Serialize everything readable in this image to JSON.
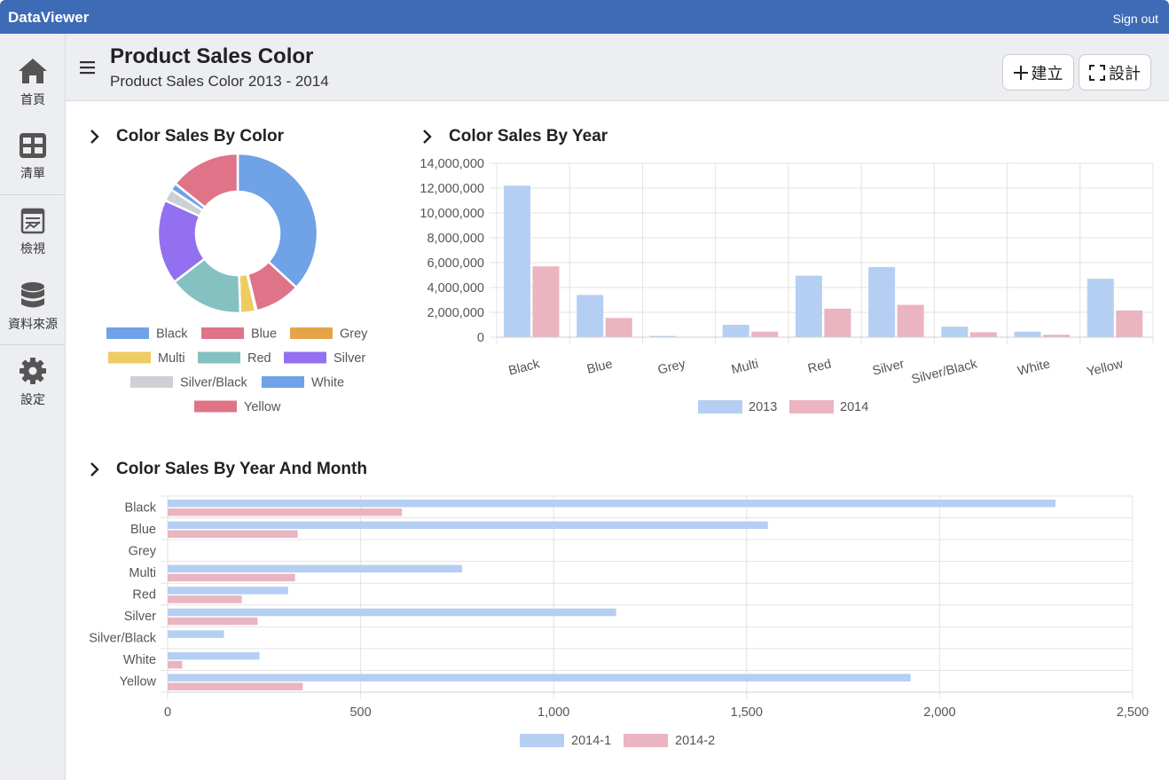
{
  "app": {
    "brand": "DataViewer",
    "signout": "Sign out"
  },
  "sidebar": {
    "items": [
      {
        "label": "首頁",
        "icon": "home-icon"
      },
      {
        "label": "清單",
        "icon": "grid-icon"
      },
      {
        "label": "檢視",
        "icon": "view-icon"
      },
      {
        "label": "資料來源",
        "icon": "database-icon"
      },
      {
        "label": "設定",
        "icon": "gear-icon"
      }
    ]
  },
  "header": {
    "title": "Product Sales Color",
    "subtitle": "Product Sales Color 2013 - 2014",
    "create_label": "建立",
    "design_label": "設計"
  },
  "sections": {
    "by_color": "Color Sales By Color",
    "by_year": "Color Sales By Year",
    "by_month": "Color Sales By Year And Month"
  },
  "colors": {
    "blue": "#6fa2e6",
    "pink": "#df7488",
    "bar_blue": "#b5cff2",
    "bar_pink": "#eab4c0",
    "topbar": "#3d6bb5"
  },
  "chart_data": [
    {
      "type": "pie",
      "title": "Color Sales By Color",
      "labels": [
        "Black",
        "Blue",
        "Grey",
        "Multi",
        "Red",
        "Silver",
        "Silver/Black",
        "White",
        "Yellow"
      ],
      "values": [
        17.8,
        4.5,
        0.1,
        1.5,
        7.3,
        8.3,
        1.2,
        0.7,
        6.9
      ],
      "colors": [
        "#6fa2e6",
        "#df7488",
        "#e6a44a",
        "#efcb63",
        "#85c1c0",
        "#9370ef",
        "#cdd0d5",
        "#6fa2e6",
        "#df7488"
      ]
    },
    {
      "type": "bar",
      "title": "Color Sales By Year",
      "categories": [
        "Black",
        "Blue",
        "Grey",
        "Multi",
        "Red",
        "Silver",
        "Silver/Black",
        "White",
        "Yellow"
      ],
      "series": [
        {
          "name": "2013",
          "values": [
            12200000,
            3400000,
            100000,
            1000000,
            4950000,
            5650000,
            850000,
            450000,
            4700000
          ]
        },
        {
          "name": "2014",
          "values": [
            5700000,
            1550000,
            0,
            450000,
            2300000,
            2600000,
            400000,
            200000,
            2150000
          ]
        }
      ],
      "ylim": [
        0,
        14000000
      ],
      "yticks": [
        "14,000,000",
        "12,000,000",
        "10,000,000",
        "8,000,000",
        "6,000,000",
        "4,000,000",
        "2,000,000",
        "0"
      ],
      "grid": true,
      "legend": "bottom"
    },
    {
      "type": "bar",
      "orientation": "horizontal",
      "title": "Color Sales By Year And Month",
      "categories": [
        "Black",
        "Blue",
        "Grey",
        "Multi",
        "Red",
        "Silver",
        "Silver/Black",
        "White",
        "Yellow"
      ],
      "series": [
        {
          "name": "2014-1",
          "values": [
            2300,
            1555,
            0,
            763,
            312,
            1162,
            146,
            238,
            1925
          ]
        },
        {
          "name": "2014-2",
          "values": [
            607,
            337,
            0,
            330,
            192,
            233,
            0,
            38,
            350
          ]
        }
      ],
      "xlim": [
        0,
        2500
      ],
      "xticks": [
        "0",
        "500",
        "1,000",
        "1,500",
        "2,000",
        "2,500"
      ],
      "grid": true,
      "legend": "bottom"
    }
  ]
}
